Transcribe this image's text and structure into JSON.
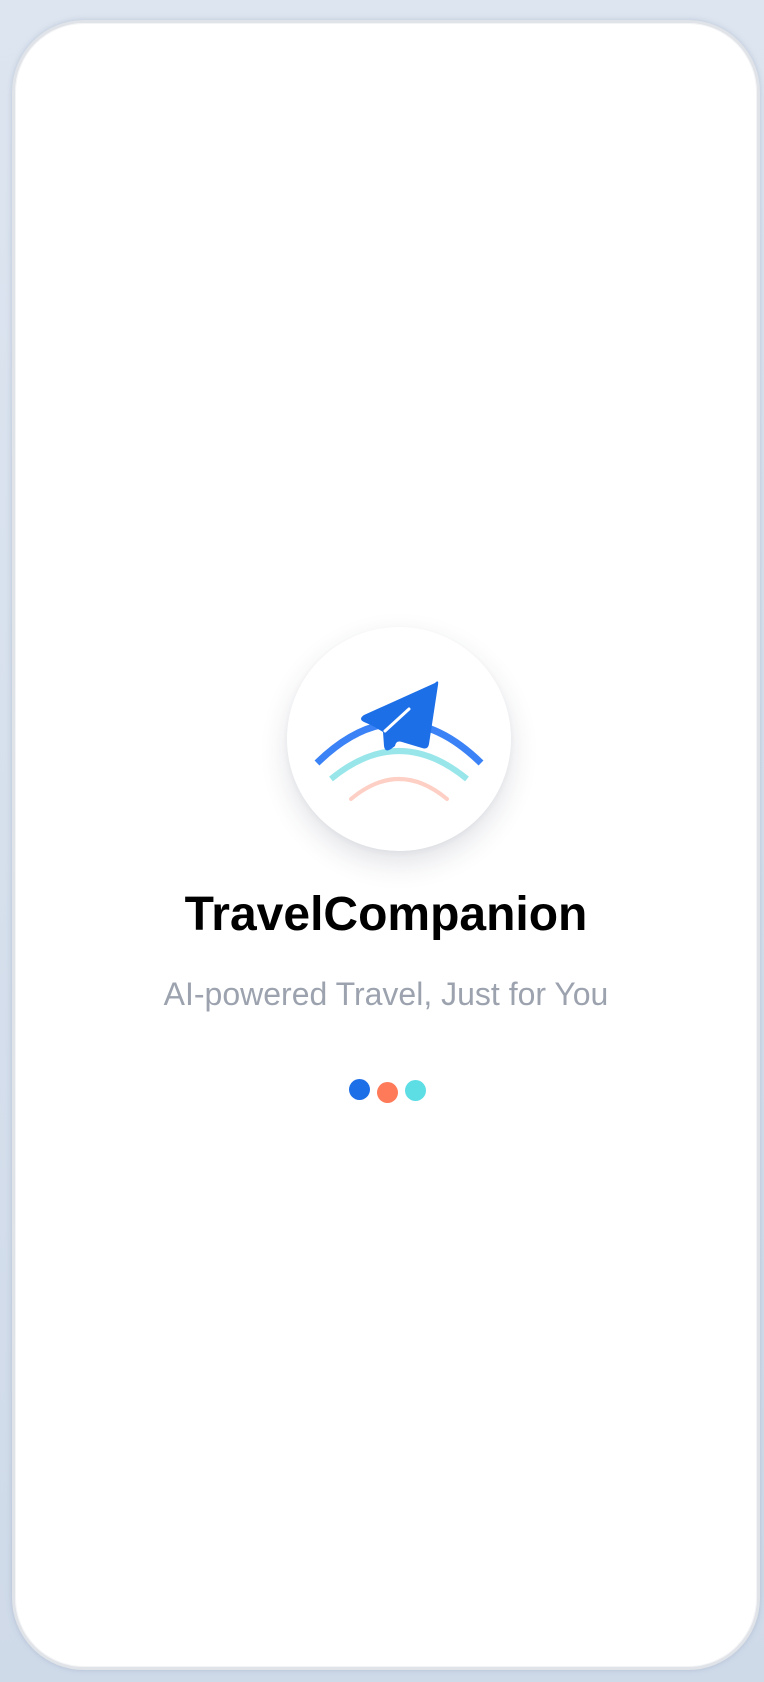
{
  "app": {
    "title": "TravelCompanion",
    "tagline": "AI-powered Travel, Just for You"
  },
  "logo": {
    "icon": "paper-plane-icon",
    "arc_colors": [
      "#3b82f6",
      "#99e6ea",
      "#fecfc4"
    ],
    "plane_color": "#1d6fe8"
  },
  "loading": {
    "indicator": "three-dot-loader",
    "dot_colors": [
      "#1d6fe8",
      "#ff7a59",
      "#5ddde4"
    ]
  },
  "theme": {
    "background": "#ffffff",
    "title_color": "#000000",
    "tagline_color": "#9ca3af"
  }
}
